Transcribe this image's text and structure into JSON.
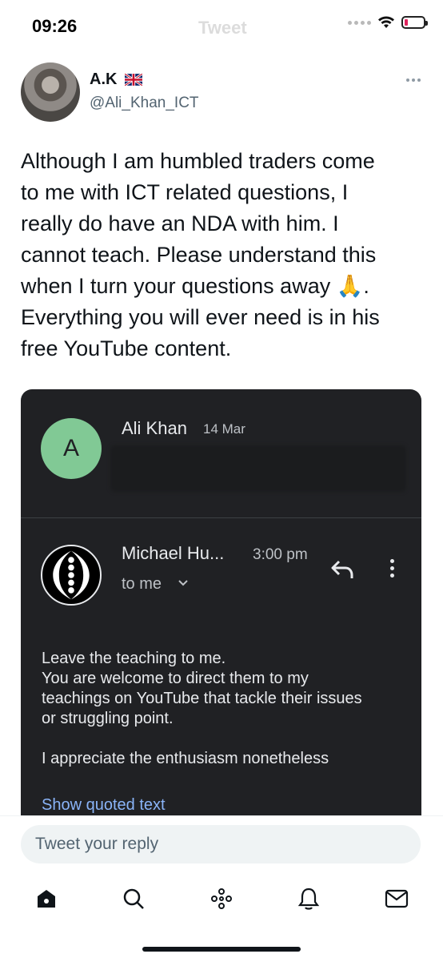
{
  "status_bar": {
    "time": "09:26",
    "title_ghost": "Tweet"
  },
  "author": {
    "display_name": "A.K",
    "handle": "@Ali_Khan_ICT",
    "flag_icon": "uk-flag-icon"
  },
  "tweet": {
    "text_lines": [
      "Although I am humbled traders come",
      "to me with ICT related questions, I",
      "really do have an NDA with him. I",
      "cannot teach. Please understand this",
      "when I turn your questions away 🙏.",
      "Everything you will ever need is in his",
      "free YouTube content."
    ]
  },
  "email": {
    "thread_sender": {
      "initial": "A",
      "name": "Ali Khan",
      "date": "14 Mar",
      "avatar_color": "#81c995"
    },
    "message": {
      "sender": "Michael Hu...",
      "time": "3:00 pm",
      "recipient": "to me",
      "body_lines": [
        "Leave the teaching to me.",
        "You are welcome to direct them to my",
        "teachings on YouTube that tackle their issues",
        "or struggling point."
      ],
      "closing": "I appreciate the enthusiasm nonetheless",
      "show_quoted": "Show quoted text"
    },
    "colors": {
      "background": "#202124",
      "link": "#8ab4f8"
    }
  },
  "reply": {
    "placeholder": "Tweet your reply"
  },
  "nav": {
    "items": [
      "home-icon",
      "search-icon",
      "spaces-icon",
      "notifications-icon",
      "messages-icon"
    ]
  }
}
